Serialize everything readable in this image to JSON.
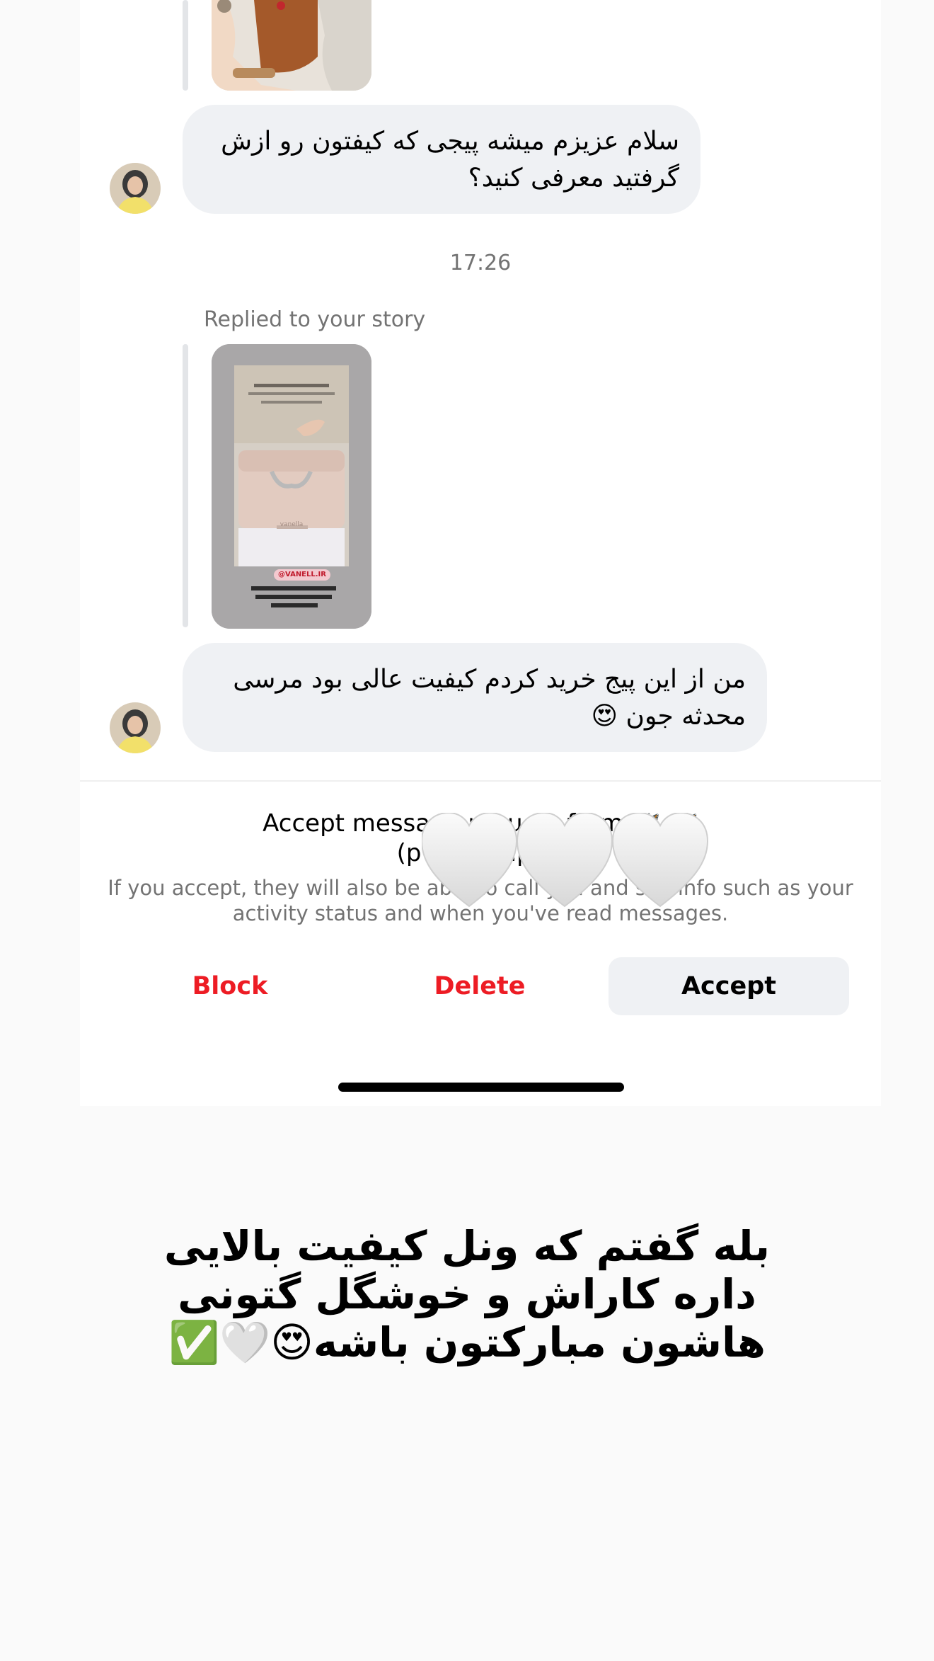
{
  "messages": [
    {
      "text": "سلام عزیزم میشه پیجی که کیفتون رو ازش گرفتید معرفی کنید؟"
    },
    {
      "text": "من از این پیج خرید کردم کیفیت عالی بود مرسی محدثه جون 😍"
    }
  ],
  "timestamp": "17:26",
  "replied_label": "Replied to your story",
  "story_preview": {
    "handle": "@VANELL.IR",
    "brand": "vanella"
  },
  "request": {
    "title_line1": "Accept message request from 🦋 🦋",
    "title_line2": "(pv_ha...tip...)",
    "subtitle": "If you accept, they will also be able to call you and see info such as your activity status and when you've read messages."
  },
  "buttons": {
    "block": "Block",
    "delete": "Delete",
    "accept": "Accept"
  },
  "overlay_caption": "بله گفتم که ونل کیفیت بالایی داره کاراش و خوشگل گتونی هاشون مبارکتون باشه😍🤍✅",
  "colors": {
    "destructive": "#ed1c24",
    "bubble": "#eff1f4",
    "secondary_text": "#737373"
  }
}
